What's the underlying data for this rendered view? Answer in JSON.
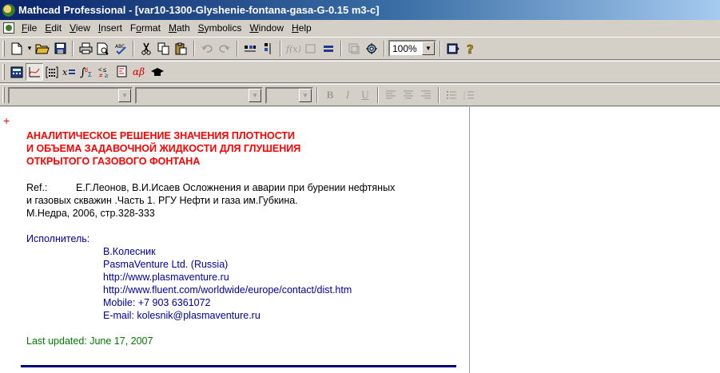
{
  "window": {
    "title": "Mathcad Professional - [var10-1300-Glyshenie-fontana-gasa-G-0.15 m3-c]"
  },
  "menu": [
    {
      "label": "File",
      "key": "F",
      "rest": "ile"
    },
    {
      "label": "Edit",
      "key": "E",
      "rest": "dit"
    },
    {
      "label": "View",
      "key": "V",
      "rest": "iew"
    },
    {
      "label": "Insert",
      "key": "I",
      "rest": "nsert"
    },
    {
      "label": "Format",
      "key": "o",
      "pre": "F",
      "rest": "rmat"
    },
    {
      "label": "Math",
      "key": "M",
      "rest": "ath"
    },
    {
      "label": "Symbolics",
      "key": "S",
      "rest": "ymbolics"
    },
    {
      "label": "Window",
      "key": "W",
      "rest": "indow"
    },
    {
      "label": "Help",
      "key": "H",
      "rest": "elp"
    }
  ],
  "toolbar": {
    "zoom": "100%"
  },
  "format_bar": {
    "style": "",
    "font": "",
    "size": ""
  },
  "document": {
    "heading": [
      "АНАЛИТИЧЕСКОЕ РЕШЕНИЕ ЗНАЧЕНИЯ ПЛОТНОСТИ",
      "И ОБЪЕМА ЗАДАВОЧНОЙ ЖИДКОСТИ ДЛЯ ГЛУШЕНИЯ",
      "ОТКРЫТОГО ГАЗОВОГО ФОНТАНА"
    ],
    "ref_label": "Ref.:",
    "ref_lines": [
      "Е.Г.Леонов, В.И.Исаев Осложнения и аварии при бурении нефтяных",
      "и газовых скважин .Часть 1. РГУ Нефти и газа им.Губкина.",
      "М.Недра, 2006,  стр.328-333"
    ],
    "executor_label": "Исполнитель:",
    "executor_lines": [
      "В.Колесник",
      "PasmaVenture Ltd. (Russia)",
      "http://www.plasmaventure.ru",
      "http://www.fluent.com/worldwide/europe/contact/dist.htm",
      "Mobile: +7 903 6361072",
      "E-mail: kolesnik@plasmaventure.ru"
    ],
    "last_updated": "Last updated: June 17, 2007"
  },
  "colors": {
    "heading": "#ff0000",
    "executor": "#0000a0",
    "updated": "#007a00",
    "rule": "#000080"
  }
}
